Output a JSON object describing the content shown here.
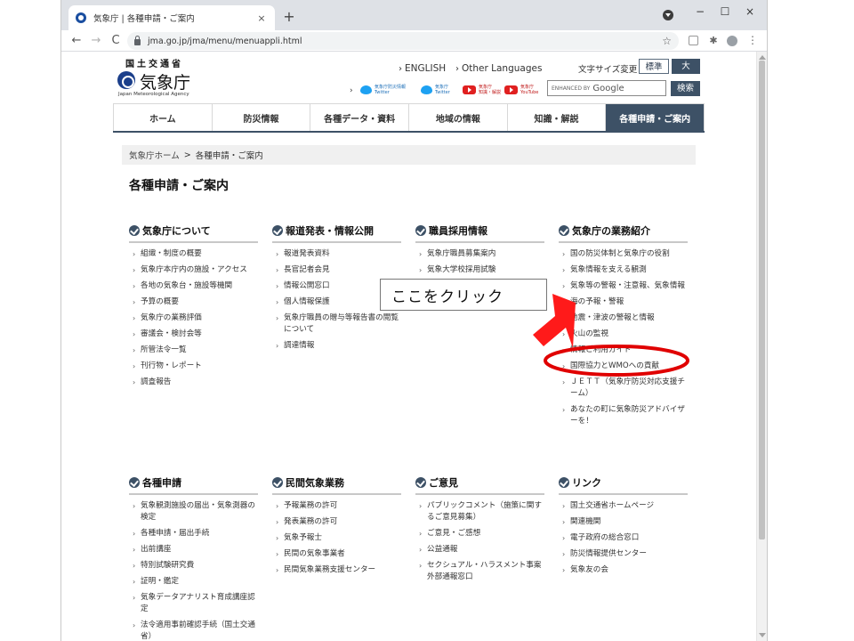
{
  "browser": {
    "tab_title": "気象庁 | 各種申請・ご案内",
    "tab_close": "×",
    "new_tab": "+",
    "url": "jma.go.jp/jma/menu/menuappli.html",
    "nav": {
      "back": "←",
      "forward": "→",
      "reload": "C"
    },
    "star": "☆",
    "window_controls": {
      "minimize": "−",
      "maximize": "☐",
      "close": "×"
    },
    "menu": "⋮"
  },
  "header": {
    "ministry": "国土交通省",
    "agency": "気象庁",
    "agency_en": "Japan Meteorological Agency",
    "english_link": "ENGLISH",
    "other_languages_link": "Other Languages",
    "font_size_label": "文字サイズ変更",
    "font_standard": "標準",
    "font_large": "大",
    "social": [
      {
        "icon": "twitter-icon",
        "label_line1": "気象庁防災情報",
        "label_line2": "Twitter"
      },
      {
        "icon": "twitter-icon",
        "label_line1": "気象庁",
        "label_line2": "Twitter"
      },
      {
        "icon": "youtube-icon",
        "label_line1": "気象庁",
        "label_line2": "知識・解説"
      },
      {
        "icon": "youtube-icon",
        "label_line1": "気象庁",
        "label_line2": "YouTube"
      }
    ],
    "search_enhanced": "ENHANCED BY",
    "search_google": "Google",
    "search_button": "検索"
  },
  "mainnav": {
    "items": [
      "ホーム",
      "防災情報",
      "各種データ・資料",
      "地域の情報",
      "知識・解説",
      "各種申請・ご案内"
    ]
  },
  "breadcrumb": {
    "home": "気象庁ホーム",
    "separator": ">",
    "current": "各種申請・ご案内"
  },
  "page_title": "各種申請・ご案内",
  "sections": {
    "about": {
      "title": "気象庁について",
      "items": [
        "組織・制度の概要",
        "気象庁本庁内の施設・アクセス",
        "各地の気象台・施設等機関",
        "予算の概要",
        "気象庁の業務評価",
        "審議会・検討会等",
        "所管法令一覧",
        "刊行物・レポート",
        "調査報告"
      ]
    },
    "press": {
      "title": "報道発表・情報公開",
      "items": [
        "報道発表資料",
        "長官記者会見",
        "情報公開窓口",
        "個人情報保護",
        "気象庁職員の贈与等報告書の閲覧について",
        "調達情報"
      ]
    },
    "recruit": {
      "title": "職員採用情報",
      "items": [
        "気象庁職員募集案内",
        "気象大学校採用試験"
      ]
    },
    "business": {
      "title": "気象庁の業務紹介",
      "items": [
        "国の防災体制と気象庁の役割",
        "気象情報を支える観測",
        "気象等の警報・注意報、気象情報",
        "海の予報・警報",
        "地震・津波の警報と情報",
        "火山の監視",
        "情報ご利用ガイド",
        "国際協力とWMOへの貢献",
        "ＪＥＴＴ（気象庁防災対応支援チーム）",
        "あなたの町に気象防災アドバイザーを！"
      ]
    },
    "apply": {
      "title": "各種申請",
      "items": [
        "気象観測施設の届出・気象測器の検定",
        "各種申請・届出手続",
        "出前講座",
        "特別試験研究費",
        "証明・鑑定",
        "気象データアナリスト育成講座認定",
        "法令適用事前確認手続（国土交通省）"
      ]
    },
    "private": {
      "title": "民間気象業務",
      "items": [
        "予報業務の許可",
        "発表業務の許可",
        "気象予報士",
        "民間の気象事業者",
        "民間気象業務支援センター"
      ]
    },
    "opinion": {
      "title": "ご意見",
      "items": [
        "パブリックコメント（施策に関するご意見募集）",
        "ご意見・ご感想",
        "公益通報",
        "セクシュアル・ハラスメント事案外部通報窓口"
      ]
    },
    "links": {
      "title": "リンク",
      "items": [
        "国土交通省ホームページ",
        "関連機関",
        "電子政府の総合窓口",
        "防災情報提供センター",
        "気象友の会"
      ]
    }
  },
  "annotation": {
    "callout_text": "ここをクリック",
    "arrow_color": "#ff1a1a",
    "ellipse_color": "#e00000"
  },
  "colors": {
    "accent": "#3d5166",
    "tab_strip": "#dee1e6"
  }
}
